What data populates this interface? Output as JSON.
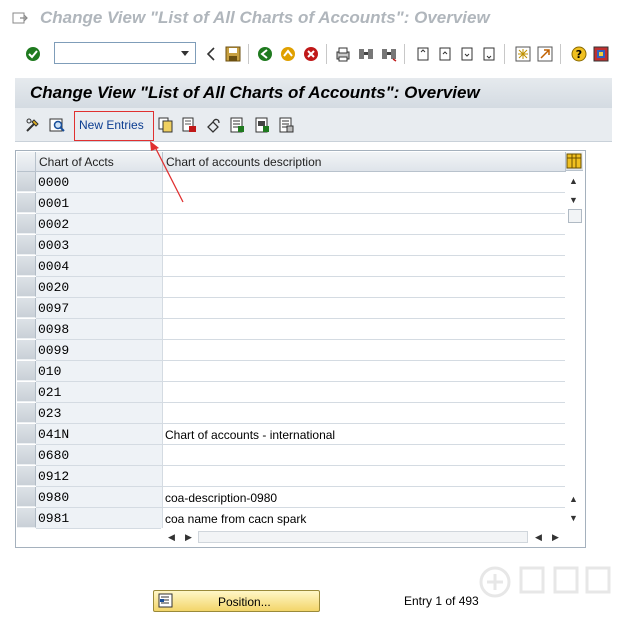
{
  "window": {
    "title": "Change View \"List of All Charts of Accounts\": Overview"
  },
  "std_toolbar": {
    "command_field_value": "",
    "icons": [
      "enter-icon",
      "back-nav-icon",
      "save-icon",
      "back-icon",
      "exit-icon",
      "cancel-icon",
      "print-icon",
      "find-icon",
      "find-next-icon",
      "first-page-icon",
      "previous-page-icon",
      "next-page-icon",
      "last-page-icon",
      "new-session-icon",
      "shortcut-icon",
      "help-icon",
      "customize-layout-icon"
    ]
  },
  "screen": {
    "title": "Change View \"List of All Charts of Accounts\": Overview"
  },
  "app_toolbar": {
    "new_entries_label": "New Entries",
    "icons": [
      "display-change-icon",
      "details-icon",
      "copy-as-icon",
      "delete-icon",
      "undo-change-icon",
      "select-all-icon",
      "select-block-icon",
      "deselect-all-icon"
    ]
  },
  "table": {
    "columns": [
      "Chart of Accts",
      "Chart of accounts description"
    ],
    "rows": [
      {
        "code": "0000",
        "description": ""
      },
      {
        "code": "0001",
        "description": ""
      },
      {
        "code": "0002",
        "description": ""
      },
      {
        "code": "0003",
        "description": ""
      },
      {
        "code": "0004",
        "description": ""
      },
      {
        "code": "0020",
        "description": ""
      },
      {
        "code": "0097",
        "description": ""
      },
      {
        "code": "0098",
        "description": ""
      },
      {
        "code": "0099",
        "description": ""
      },
      {
        "code": "010",
        "description": ""
      },
      {
        "code": "021",
        "description": ""
      },
      {
        "code": "023",
        "description": ""
      },
      {
        "code": "041N",
        "description": "Chart of accounts - international"
      },
      {
        "code": "0680",
        "description": ""
      },
      {
        "code": "0912",
        "description": ""
      },
      {
        "code": "0980",
        "description": "coa-description-0980"
      },
      {
        "code": "0981",
        "description": "coa name from cacn spark"
      }
    ]
  },
  "footer": {
    "position_button_label": "Position...",
    "entry_info": "Entry 1 of 493"
  },
  "colors": {
    "highlight": "#e03030",
    "header_bg": "#d4dbe2",
    "position_button": "#f3d56a"
  }
}
